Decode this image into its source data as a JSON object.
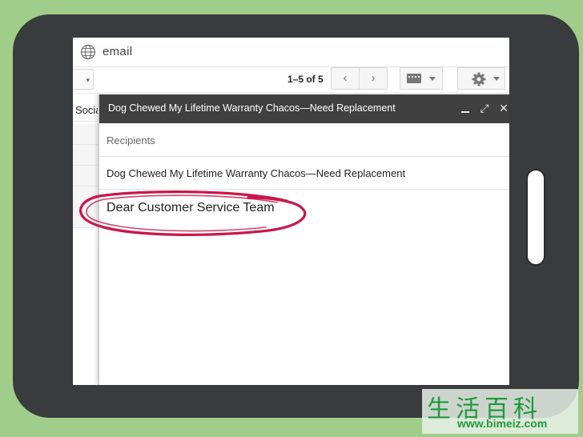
{
  "address_bar": {
    "url": "email",
    "icon": "globe-icon"
  },
  "toolbar": {
    "pager": "1–5 of 5",
    "prev_icon": "‹",
    "next_icon": "›",
    "keyboard_icon": "keyboard-icon",
    "settings_icon": "gear-icon"
  },
  "mail_list": {
    "tab_label": "Socia"
  },
  "compose": {
    "title": "Dog Chewed My Lifetime Warranty Chacos—Need Replacement",
    "minimize_icon": "minimize-icon",
    "expand_icon": "⤢",
    "close_icon": "✕",
    "recipients_placeholder": "Recipients",
    "subject": "Dog Chewed My Lifetime Warranty Chacos—Need Replacement",
    "body": "Dear Customer Service Team",
    "highlight_color": "#c8174a"
  },
  "watermark": {
    "chars": "生活百科",
    "url": "www.bimeiz.com"
  }
}
